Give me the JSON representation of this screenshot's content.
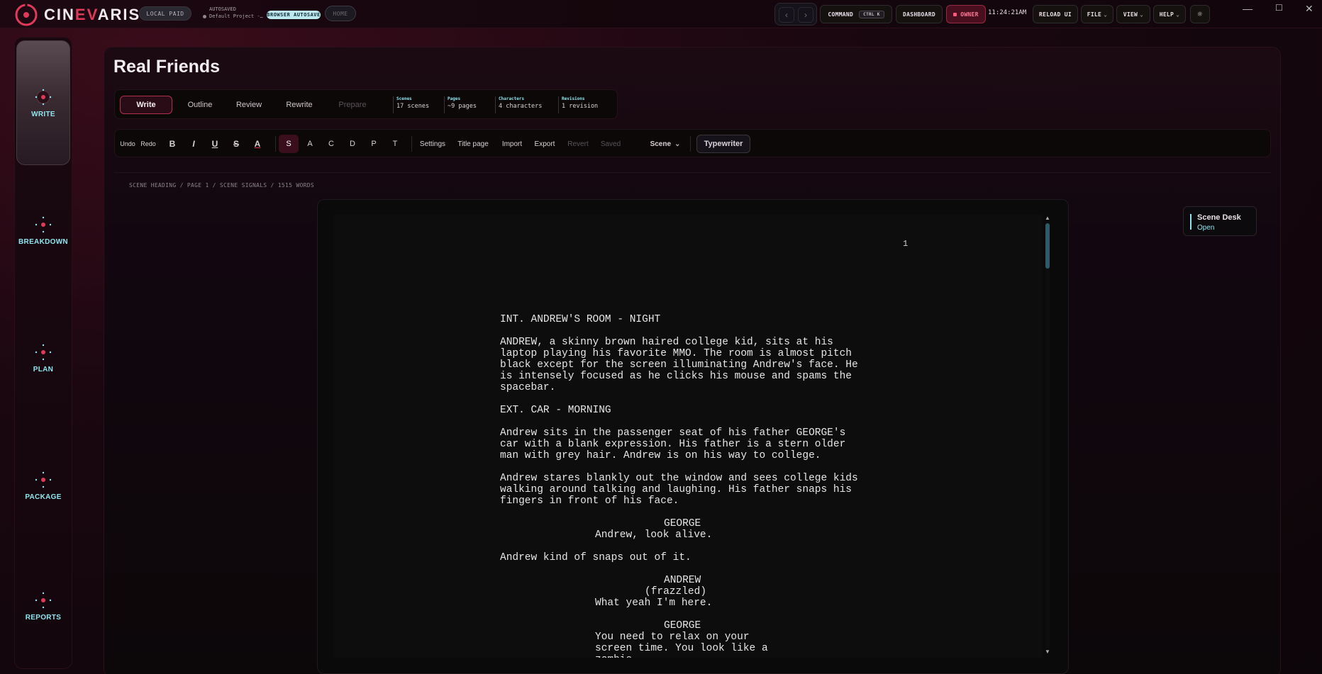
{
  "app": {
    "brand_left": "CIN",
    "brand_em": "EV",
    "brand_right": "ARIS",
    "plan_badge": "LOCAL PAID",
    "autosave_label": "AUTOSAVED",
    "project_name": "Default Project -…",
    "autosave_badge": "BROWSER AUTOSAVE",
    "home_label": "HOME"
  },
  "topbar": {
    "back_icon": "‹",
    "forward_icon": "›",
    "command_label": "COMMAND",
    "command_shortcut": "CTRL K",
    "dashboard_label": "DASHBOARD",
    "owner_label": "OWNER",
    "clock": "11:24:21AM",
    "reload_label": "RELOAD UI",
    "file_label": "FILE",
    "view_label": "VIEW",
    "help_label": "HELP",
    "minimize_icon": "—",
    "maximize_icon": "☐",
    "close_icon": "✕"
  },
  "rail": {
    "items": [
      {
        "label": "WRITE"
      },
      {
        "label": "BREAKDOWN"
      },
      {
        "label": "PLAN"
      },
      {
        "label": "PACKAGE"
      },
      {
        "label": "REPORTS"
      }
    ]
  },
  "page": {
    "title": "Real Friends"
  },
  "modes": [
    {
      "label": "Write"
    },
    {
      "label": "Outline"
    },
    {
      "label": "Review"
    },
    {
      "label": "Rewrite"
    },
    {
      "label": "Prepare"
    }
  ],
  "stats": [
    {
      "key": "Scenes",
      "value": "17 scenes"
    },
    {
      "key": "Pages",
      "value": "~9 pages"
    },
    {
      "key": "Characters",
      "value": "4 characters"
    },
    {
      "key": "Revisions",
      "value": "1 revision"
    }
  ],
  "toolbar": {
    "undo": "Undo",
    "redo": "Redo",
    "bold": "B",
    "italic": "I",
    "underline": "U",
    "strike": "S",
    "color": "A",
    "elements": [
      "S",
      "A",
      "C",
      "D",
      "P",
      "T"
    ],
    "settings": "Settings",
    "title_page": "Title page",
    "import": "Import",
    "export": "Export",
    "revert": "Revert",
    "saved": "Saved",
    "scene_select": "Scene",
    "typewriter": "Typewriter"
  },
  "breadcrumb": "SCENE HEADING / PAGE 1 / SCENE SIGNALS / 1515 WORDS",
  "script": {
    "page_number": "1",
    "heading1": "INT. ANDREW'S ROOM - NIGHT",
    "action1": "ANDREW, a skinny brown haired college kid, sits at his\nlaptop playing his favorite MMO. The room is almost pitch\nblack except for the screen illuminating Andrew's face. He\nis intensely focused as he clicks his mouse and spams the\nspacebar.",
    "heading2": "EXT. CAR - MORNING",
    "action2": "Andrew sits in the passenger seat of his father GEORGE's\ncar with a blank expression. His father is a stern older\nman with grey hair. Andrew is on his way to college.",
    "action3": "Andrew stares blankly out the window and sees college kids\nwalking around talking and laughing. His father snaps his\nfingers in front of his face.",
    "char1": "GEORGE",
    "dialogue1": "Andrew, look alive.",
    "action4": "Andrew kind of snaps out of it.",
    "char2": "ANDREW",
    "paren2": "(frazzled)",
    "dialogue2": "What yeah I'm here.",
    "char3": "GEORGE",
    "dialogue3": "You need to relax on your\nscreen time. You look like a\nzombie."
  },
  "scene_desk": {
    "title": "Scene Desk",
    "status": "Open"
  },
  "colors": {
    "accent": "#e03a5a",
    "cyan": "#8fe5ef"
  }
}
